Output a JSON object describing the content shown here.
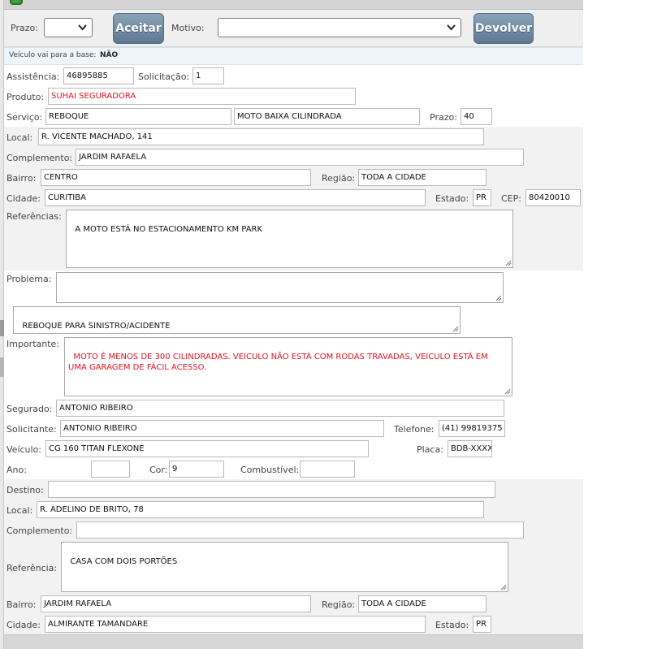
{
  "toolbar": {
    "prazo_label": "Prazo:",
    "prazo_value": "",
    "aceitar_label": "Aceitar",
    "motivo_label": "Motivo:",
    "motivo_value": "",
    "devolver_label": "Devolver"
  },
  "info": {
    "base_text": "Veículo vai para a base:",
    "base_value": "NÃO"
  },
  "form": {
    "assistencia_label": "Assistência:",
    "assistencia_value": "46895885",
    "solicitacao_label": "Solicitação:",
    "solicitacao_value": "1",
    "produto_label": "Produto:",
    "produto_value": "SUHAI SEGURADORA",
    "servico_label": "Serviço:",
    "servico_value": "REBOQUE",
    "servico_tipo_value": "MOTO BAIXA CILINDRADA",
    "prazo_label": "Prazo:",
    "prazo_value": "40",
    "local_label": "Local:",
    "local_value": "R. VICENTE MACHADO, 141",
    "complemento_label": "Complemento:",
    "complemento_value": "JARDIM RAFAELA",
    "bairro_label": "Bairro:",
    "bairro_value": "CENTRO",
    "regiao_label": "Região:",
    "regiao_value": "TODA A CIDADE",
    "cidade_label": "Cidade:",
    "cidade_value": "CURITIBA",
    "estado_label": "Estado:",
    "estado_value": "PR",
    "cep_label": "CEP:",
    "cep_value": "80420010",
    "referencias_label": "Referências:",
    "referencias_value": "A MOTO ESTÁ NO ESTACIONAMENTO KM PARK",
    "problema_label": "Problema:",
    "problema_value": "",
    "problema_desc_value": "REBOQUE PARA SINISTRO/ACIDENTE",
    "importante_label": "Importante:",
    "importante_value": "MOTO É MENOS DE 300 CILINDRADAS. VEICULO NÃO ESTÁ COM RODAS TRAVADAS, VEICULO ESTÁ EM UMA GARAGEM DE FÁCIL ACESSO.",
    "segurado_label": "Segurado:",
    "segurado_value": "ANTONIO RIBEIRO",
    "solicitante_label": "Solicitante:",
    "solicitante_value": "ANTONIO RIBEIRO",
    "telefone_label": "Telefone:",
    "telefone_value": "(41) 99819375",
    "veiculo_label": "Veículo:",
    "veiculo_value": "CG 160 TITAN FLEXONE",
    "placa_label": "Placa:",
    "placa_value": "BDB-XXXX",
    "ano_label": "Ano:",
    "ano_value": "",
    "cor_label": "Cor:",
    "cor_value": "9",
    "combustivel_label": "Combustível:",
    "combustivel_value": ""
  },
  "destino": {
    "destino_label": "Destino:",
    "destino_value": "",
    "local_label": "Local:",
    "local_value": "R. ADELINO DE BRITO, 78",
    "complemento_label": "Complemento:",
    "complemento_value": "",
    "referencia_label": "Referência:",
    "referencia_value": "CASA COM DOIS PORTÕES",
    "bairro_label": "Bairro:",
    "bairro_value": "JARDIM RAFAELA",
    "regiao_label": "Região:",
    "regiao_value": "TODA A CIDADE",
    "cidade_label": "Cidade:",
    "cidade_value": "ALMIRANTE TAMANDARE",
    "estado_label": "Estado:",
    "estado_value": "PR"
  },
  "colors": {
    "button": "#6f89a1",
    "red_text": "#e0141e",
    "band": "#f2f2f2"
  }
}
